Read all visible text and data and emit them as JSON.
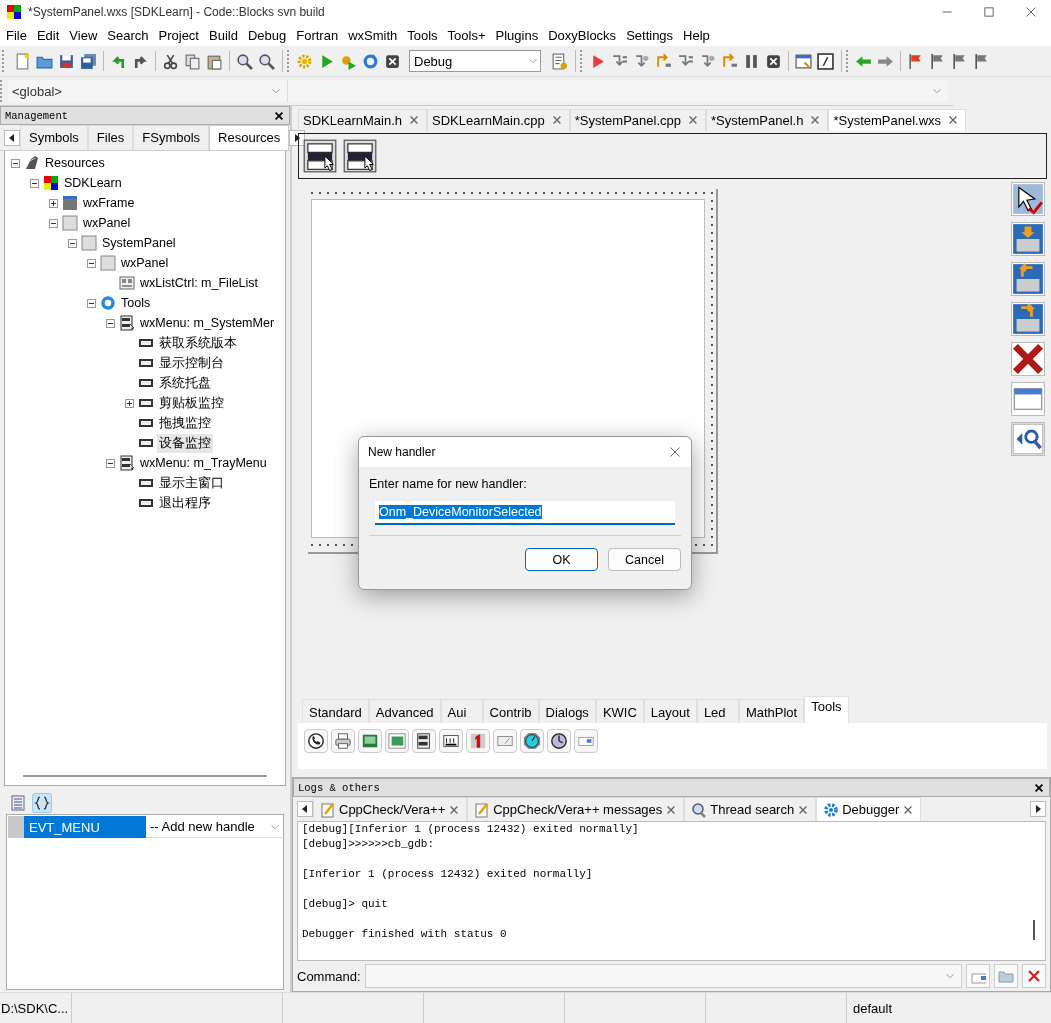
{
  "window": {
    "title": "*SystemPanel.wxs [SDKLearn] - Code::Blocks svn build"
  },
  "menu": [
    "File",
    "Edit",
    "View",
    "Search",
    "Project",
    "Build",
    "Debug",
    "Fortran",
    "wxSmith",
    "Tools",
    "Tools+",
    "Plugins",
    "DoxyBlocks",
    "Settings",
    "Help"
  ],
  "toolbar": {
    "build_target": "Debug"
  },
  "code_toolbar": {
    "scope": "<global>"
  },
  "management": {
    "title": "Management",
    "tabs": [
      {
        "label": "Symbols",
        "selected": false
      },
      {
        "label": "Files",
        "selected": false
      },
      {
        "label": "FSymbols",
        "selected": false
      },
      {
        "label": "Resources",
        "selected": true
      }
    ],
    "tree": [
      {
        "label": "Resources",
        "kind": "resources",
        "expanded": true,
        "selected": false,
        "children": [
          {
            "label": "SDKLearn",
            "kind": "project",
            "expanded": true,
            "selected": false,
            "children": [
              {
                "label": "wxFrame",
                "kind": "frame",
                "expanded": false,
                "selected": false
              },
              {
                "label": "wxPanel",
                "kind": "panel",
                "expanded": true,
                "selected": false,
                "children": [
                  {
                    "label": "SystemPanel",
                    "kind": "panel",
                    "expanded": true,
                    "selected": false,
                    "children": [
                      {
                        "label": "wxPanel",
                        "kind": "panel",
                        "expanded": true,
                        "selected": false,
                        "children": [
                          {
                            "label": "wxListCtrl: m_FileList",
                            "kind": "listctrl",
                            "selected": false
                          }
                        ]
                      },
                      {
                        "label": "Tools",
                        "kind": "tools",
                        "expanded": true,
                        "selected": false,
                        "children": [
                          {
                            "label": "wxMenu: m_SystemMer",
                            "kind": "menu",
                            "expanded": true,
                            "selected": false,
                            "children": [
                              {
                                "label": "获取系统版本",
                                "kind": "menuitem",
                                "selected": false
                              },
                              {
                                "label": "显示控制台",
                                "kind": "menuitem",
                                "selected": false
                              },
                              {
                                "label": "系统托盘",
                                "kind": "menuitem",
                                "selected": false
                              },
                              {
                                "label": "剪贴板监控",
                                "kind": "menuitem",
                                "expanded": false,
                                "selected": false
                              },
                              {
                                "label": "拖拽监控",
                                "kind": "menuitem",
                                "selected": false
                              },
                              {
                                "label": "设备监控",
                                "kind": "menuitem",
                                "selected": true
                              }
                            ]
                          },
                          {
                            "label": "wxMenu: m_TrayMenu",
                            "kind": "menu",
                            "expanded": true,
                            "selected": false,
                            "children": [
                              {
                                "label": "显示主窗口",
                                "kind": "menuitem",
                                "selected": false
                              },
                              {
                                "label": "退出程序",
                                "kind": "menuitem",
                                "selected": false
                              }
                            ]
                          }
                        ]
                      }
                    ]
                  }
                ]
              }
            ]
          }
        ]
      }
    ]
  },
  "inspector": {
    "tabs": [
      {
        "kind": "properties",
        "selected": false
      },
      {
        "kind": "events",
        "selected": true
      }
    ],
    "rows": [
      {
        "name": "EVT_MENU",
        "value": "-- Add new handle",
        "selected": true
      }
    ]
  },
  "editor": {
    "tabs": [
      {
        "label": "SDKLearnMain.h",
        "selected": false
      },
      {
        "label": "SDKLearnMain.cpp",
        "selected": false
      },
      {
        "label": "*SystemPanel.cpp",
        "selected": false
      },
      {
        "label": "*SystemPanel.h",
        "selected": false
      },
      {
        "label": "*SystemPanel.wxs",
        "selected": true
      }
    ]
  },
  "palette": {
    "tabs": [
      {
        "label": "Standard",
        "selected": false
      },
      {
        "label": "Advanced",
        "selected": false
      },
      {
        "label": "Aui",
        "selected": false
      },
      {
        "label": "Contrib",
        "selected": false
      },
      {
        "label": "Dialogs",
        "selected": false
      },
      {
        "label": "KWIC",
        "selected": false
      },
      {
        "label": "Layout",
        "selected": false
      },
      {
        "label": "Led",
        "selected": false
      },
      {
        "label": "MathPlot",
        "selected": false
      },
      {
        "label": "Tools",
        "selected": true
      }
    ]
  },
  "logs": {
    "title": "Logs & others",
    "tabs": [
      {
        "label": "CppCheck/Vera++",
        "kind": "note",
        "selected": false
      },
      {
        "label": "CppCheck/Vera++ messages",
        "kind": "note",
        "selected": false
      },
      {
        "label": "Thread search",
        "kind": "magnifier",
        "selected": false
      },
      {
        "label": "Debugger",
        "kind": "gear",
        "selected": true
      }
    ],
    "paragraphs": [
      [
        "[debug][Inferior 1 (process 12432) exited normally]",
        "[debug]>>>>>>cb_gdb:"
      ],
      [
        "[Inferior 1 (process 12432) exited normally]"
      ],
      [
        "[debug]> quit"
      ],
      [
        "Debugger finished with status 0"
      ]
    ],
    "command_label": "Command:"
  },
  "dialog": {
    "title": "New handler",
    "prompt": "Enter name for new handler:",
    "value": "Onm_DeviceMonitorSelected",
    "buttons": [
      {
        "label": "OK",
        "default": true
      },
      {
        "label": "Cancel",
        "default": false
      }
    ]
  },
  "status_bar": {
    "path": "D:\\SDK\\C...",
    "mode": "default"
  }
}
